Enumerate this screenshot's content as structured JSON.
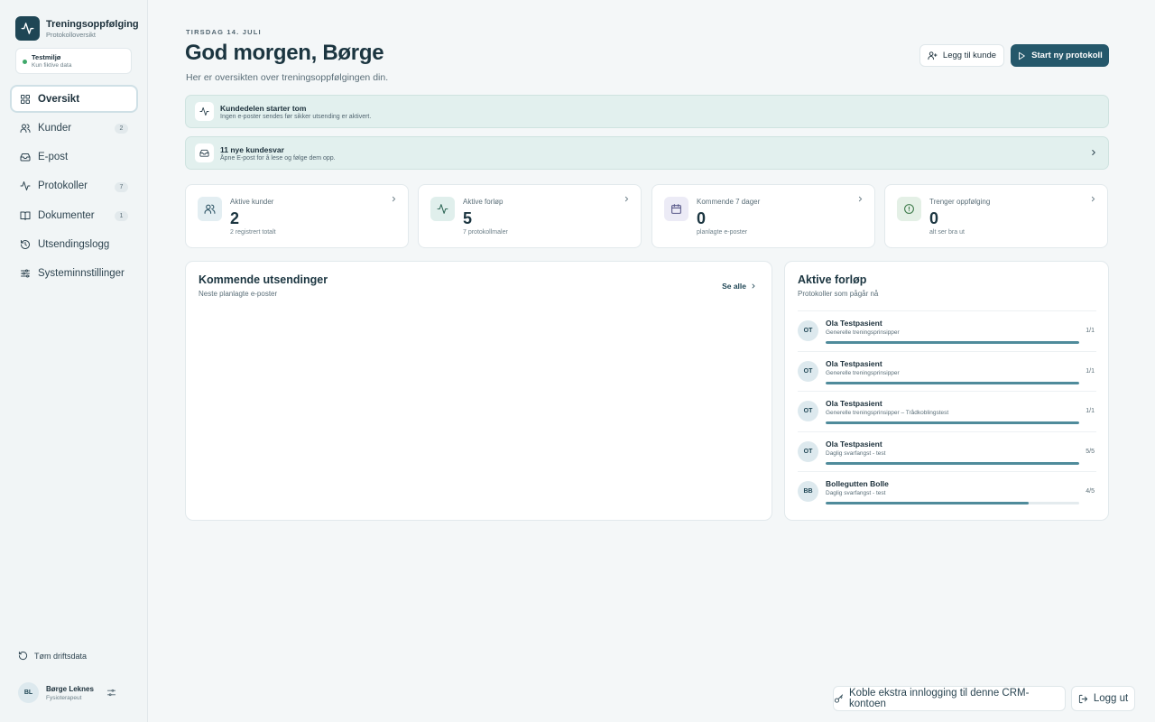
{
  "app": {
    "title": "Treningsoppfølging",
    "subtitle": "Protokolloversikt"
  },
  "environment": {
    "title": "Testmiljø",
    "subtitle": "Kun fiktive data"
  },
  "nav": [
    {
      "label": "Oversikt",
      "badge": "",
      "icon": "grid-icon"
    },
    {
      "label": "Kunder",
      "badge": "2",
      "icon": "users-icon"
    },
    {
      "label": "E-post",
      "badge": "",
      "icon": "inbox-icon"
    },
    {
      "label": "Protokoller",
      "badge": "7",
      "icon": "activity-icon"
    },
    {
      "label": "Dokumenter",
      "badge": "1",
      "icon": "book-icon"
    },
    {
      "label": "Utsendingslogg",
      "badge": "",
      "icon": "history-icon"
    },
    {
      "label": "Systeminnstillinger",
      "badge": "",
      "icon": "sliders-icon"
    }
  ],
  "sidebar_footer": {
    "reset_label": "Tøm driftsdata",
    "user": {
      "initials": "BL",
      "name": "Børge Leknes",
      "role": "Fysioterapeut"
    }
  },
  "header": {
    "date": "TIRSDAG 14. JULI",
    "greeting": "God morgen, Børge",
    "subtitle": "Her er oversikten over treningsoppfølgingen din.",
    "add_customer_label": "Legg til kunde",
    "start_protocol_label": "Start ny protokoll"
  },
  "banners": [
    {
      "title": "Kundedelen starter tom",
      "subtitle": "Ingen e-poster sendes før sikker utsending er aktivert.",
      "icon": "activity-icon"
    },
    {
      "title": "11 nye kundesvar",
      "subtitle": "Åpne E-post for å lese og følge dem opp.",
      "icon": "inbox-icon"
    }
  ],
  "stats": [
    {
      "label": "Aktive kunder",
      "value": "2",
      "sub": "2 registrert totalt",
      "icon": "users-icon",
      "color": "#e3eef2"
    },
    {
      "label": "Aktive forløp",
      "value": "5",
      "sub": "7 protokollmaler",
      "icon": "activity-icon",
      "color": "#e0efec"
    },
    {
      "label": "Kommende 7 dager",
      "value": "0",
      "sub": "planlagte e-poster",
      "icon": "calendar-icon",
      "color": "#ecebf6"
    },
    {
      "label": "Trenger oppfølging",
      "value": "0",
      "sub": "alt ser bra ut",
      "icon": "alert-circle-icon",
      "color": "#e4f0e6"
    }
  ],
  "upcoming": {
    "title": "Kommende utsendinger",
    "subtitle": "Neste planlagte e-poster",
    "see_all": "Se alle"
  },
  "active_courses": {
    "title": "Aktive forløp",
    "subtitle": "Protokoller som pågår nå",
    "items": [
      {
        "initials": "OT",
        "name": "Ola Testpasient",
        "protocol": "Generelle treningsprinsipper",
        "count": "1/1",
        "progress": 1.0
      },
      {
        "initials": "OT",
        "name": "Ola Testpasient",
        "protocol": "Generelle treningsprinsipper",
        "count": "1/1",
        "progress": 1.0
      },
      {
        "initials": "OT",
        "name": "Ola Testpasient",
        "protocol": "Generelle treningsprinsipper – Trådkoblingstest",
        "count": "1/1",
        "progress": 1.0
      },
      {
        "initials": "OT",
        "name": "Ola Testpasient",
        "protocol": "Daglig svarfangst - test",
        "count": "5/5",
        "progress": 1.0
      },
      {
        "initials": "BB",
        "name": "Bollegutten Bolle",
        "protocol": "Daglig svarfangst - test",
        "count": "4/5",
        "progress": 0.8
      }
    ]
  },
  "bottom": {
    "link_label": "Koble ekstra innlogging til denne CRM-kontoen",
    "logout_label": "Logg ut"
  },
  "colors": {
    "brand": "#1f4655",
    "primary": "#25586b",
    "banner": "#e2f0ee",
    "progress": "#4f8b9b"
  }
}
